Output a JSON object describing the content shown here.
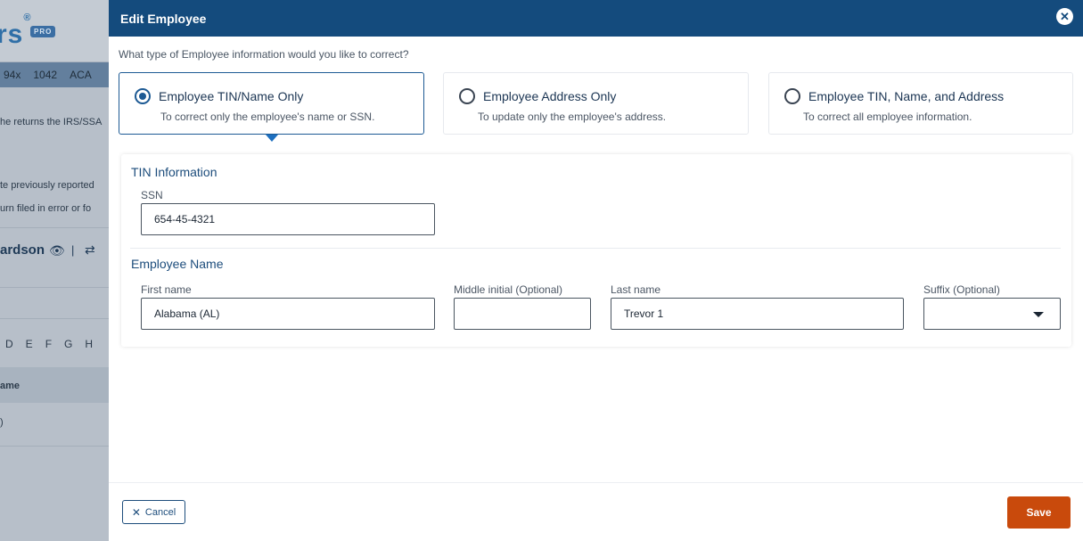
{
  "background": {
    "logo": "rs",
    "logo_mark": "®",
    "pro_badge": "PRO",
    "nav_items": [
      "94x",
      "1042",
      "ACA"
    ],
    "line1": "he returns the IRS/SSA",
    "line2": "te previously reported",
    "line3": "urn filed in error or fo",
    "name": "ardson",
    "eye_icon": "👁",
    "pipe": "|",
    "swap_icon": "⇄",
    "letters": [
      "D",
      "E",
      "F",
      "G",
      "H"
    ],
    "col_header": "ame",
    "cell": ")"
  },
  "modal": {
    "title": "Edit Employee",
    "close_icon": "✕",
    "question": "What type of Employee information would you like to correct?",
    "options": [
      {
        "title": "Employee TIN/Name Only",
        "desc": "To correct only the employee's name or SSN.",
        "selected": true
      },
      {
        "title": "Employee Address Only",
        "desc": "To update only the employee's address.",
        "selected": false
      },
      {
        "title": "Employee TIN, Name, and Address",
        "desc": "To correct all employee information.",
        "selected": false
      }
    ],
    "tin_section": {
      "title": "TIN Information",
      "ssn_label": "SSN",
      "ssn_value": "654-45-4321"
    },
    "name_section": {
      "title": "Employee Name",
      "first_label": "First name",
      "first_value": "Alabama (AL)",
      "middle_label": "Middle initial (Optional)",
      "middle_value": "",
      "last_label": "Last name",
      "last_value": "Trevor 1",
      "suffix_label": "Suffix (Optional)",
      "suffix_value": ""
    },
    "footer": {
      "cancel_icon": "✕",
      "cancel_label": "Cancel",
      "save_label": "Save"
    }
  },
  "colors": {
    "header_bg": "#144b7d",
    "accent": "#1d5a94",
    "save_bg": "#c94a0c"
  }
}
